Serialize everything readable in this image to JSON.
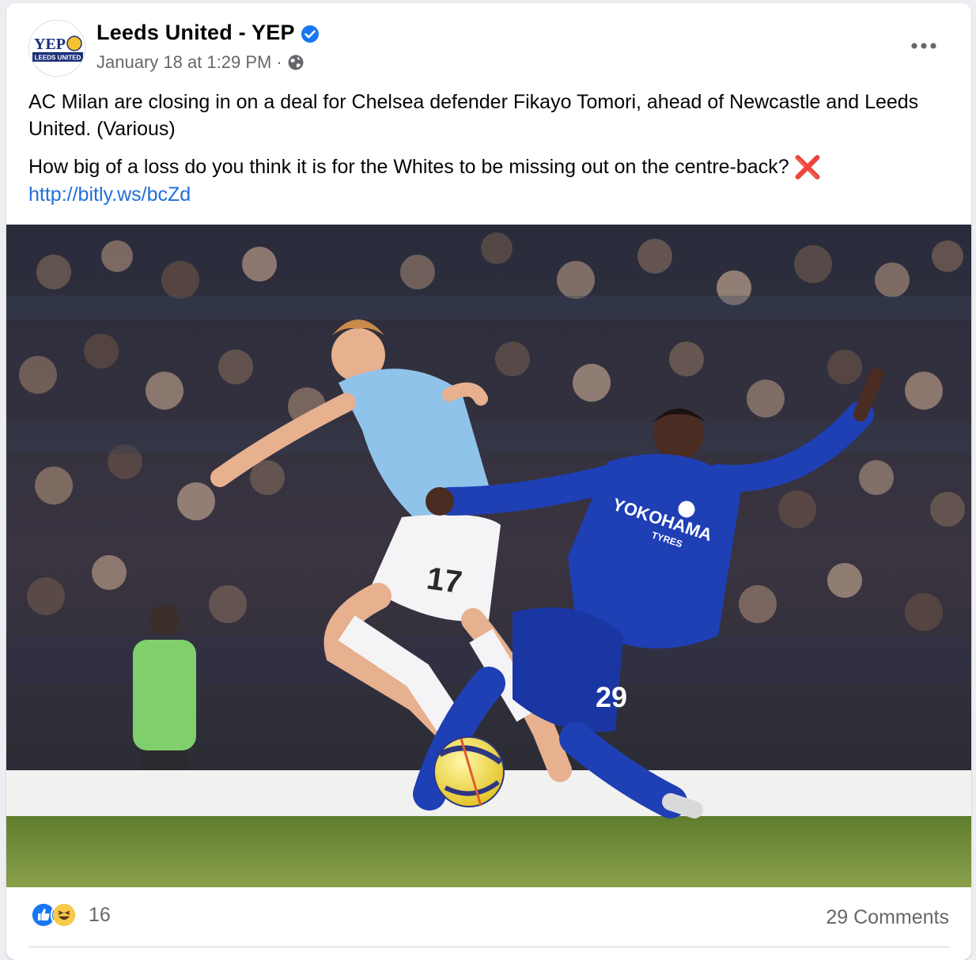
{
  "post": {
    "page_name": "Leeds United - YEP",
    "avatar_text": {
      "top": "YEP",
      "bottom": "LEEDS UNITED"
    },
    "timestamp": "January 18 at 1:29 PM",
    "separator": "·",
    "privacy_icon": "globe-icon",
    "verified_icon": "verified-badge-icon",
    "more_icon": "more-options-icon",
    "paragraph_1": "AC Milan are closing in on a deal for Chelsea defender Fikayo Tomori, ahead of Newcastle and Leeds United. (Various)",
    "paragraph_2": "How big of a loss do you think it is for the Whites to be missing out on the centre-back?",
    "emoji": "❌",
    "link": "http://bitly.ws/bcZd"
  },
  "photo": {
    "player_1_number": "17",
    "player_2_number": "29",
    "sponsor": "YOKOHAMA",
    "sponsor_sub": "TYRES"
  },
  "footer": {
    "reaction_icons": [
      "like-icon",
      "haha-icon"
    ],
    "reaction_count": "16",
    "comments": "29 Comments"
  },
  "colors": {
    "link": "#216fdb",
    "secondary_text": "#65676b",
    "verified": "#1877f2"
  }
}
